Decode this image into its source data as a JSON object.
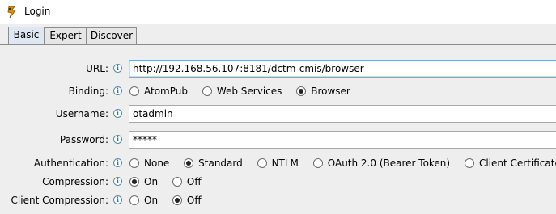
{
  "window": {
    "title": "Login"
  },
  "tabs": [
    {
      "label": "Basic",
      "active": true
    },
    {
      "label": "Expert",
      "active": false
    },
    {
      "label": "Discover",
      "active": false
    }
  ],
  "form": {
    "url": {
      "label": "URL:",
      "value": "http://192.168.56.107:8181/dctm-cmis/browser"
    },
    "binding": {
      "label": "Binding:",
      "options": [
        "AtomPub",
        "Web Services",
        "Browser"
      ],
      "selected": "Browser"
    },
    "username": {
      "label": "Username:",
      "value": "otadmin"
    },
    "password": {
      "label": "Password:",
      "value": "*****"
    },
    "authentication": {
      "label": "Authentication:",
      "options": [
        "None",
        "Standard",
        "NTLM",
        "OAuth 2.0 (Bearer Token)",
        "Client Certificate"
      ],
      "selected": "Standard"
    },
    "compression": {
      "label": "Compression:",
      "options": [
        "On",
        "Off"
      ],
      "selected": "On"
    },
    "client_compression": {
      "label": "Client Compression:",
      "options": [
        "On",
        "Off"
      ],
      "selected": "Off"
    }
  },
  "icons": {
    "info": "info-icon",
    "app": "app-icon"
  },
  "colors": {
    "tab_active": "#dfe8f2",
    "info_icon": "#3d6ea8",
    "field_focus": "#7aa7d6"
  }
}
